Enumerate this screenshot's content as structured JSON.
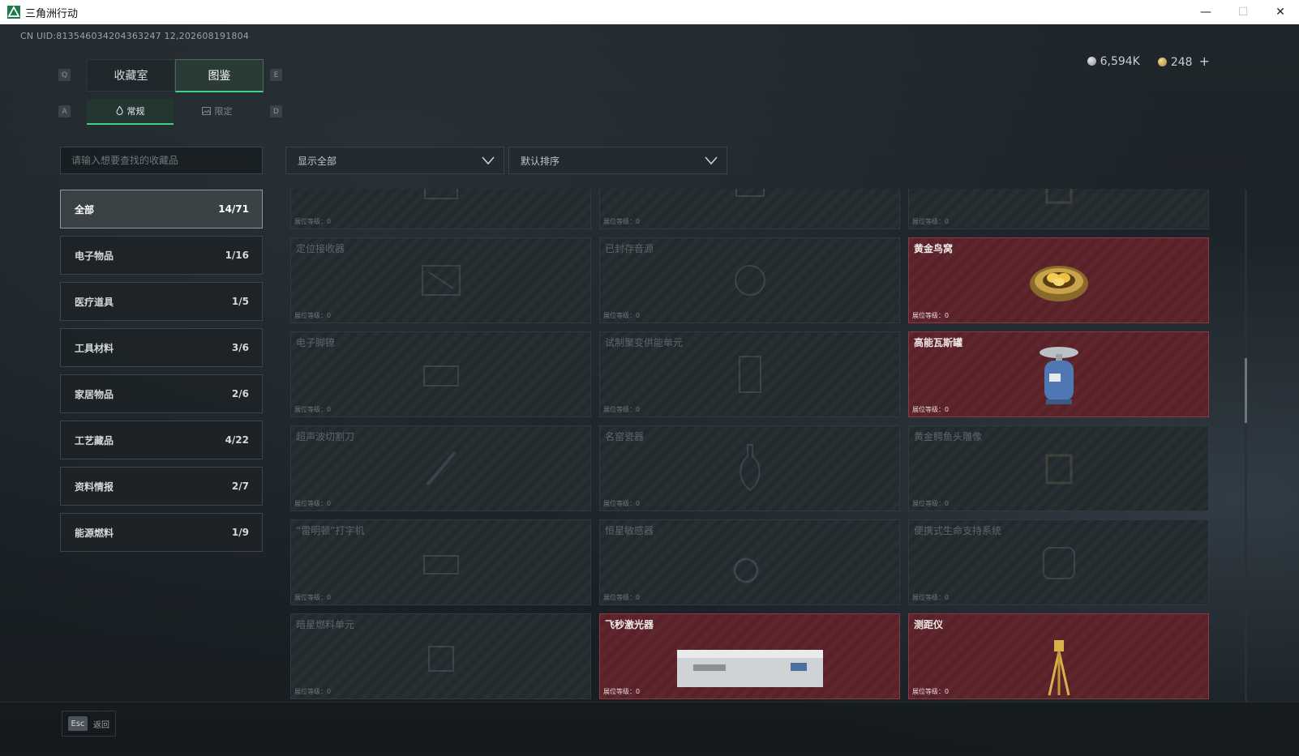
{
  "window": {
    "title": "三角洲行动",
    "minimize": "—",
    "maximize": "☐",
    "close": "✕"
  },
  "uid": "CN UID:813546034204363247 12,202608191804",
  "currency": {
    "silver": "6,594K",
    "gold": "248",
    "add": "+"
  },
  "hotkeys": {
    "q": "Q",
    "e": "E",
    "a": "A",
    "d": "D"
  },
  "tabs_main": [
    "收藏室",
    "图鉴"
  ],
  "tabs_sub": [
    "常规",
    "限定"
  ],
  "search": {
    "placeholder": "请输入想要查找的收藏品"
  },
  "filters": {
    "display": "显示全部",
    "sort": "默认排序"
  },
  "categories": [
    {
      "label": "全部",
      "count": "14/71"
    },
    {
      "label": "电子物品",
      "count": "1/16"
    },
    {
      "label": "医疗道具",
      "count": "1/5"
    },
    {
      "label": "工具材料",
      "count": "3/6"
    },
    {
      "label": "家居物品",
      "count": "2/6"
    },
    {
      "label": "工艺藏品",
      "count": "4/22"
    },
    {
      "label": "资料情报",
      "count": "2/7"
    },
    {
      "label": "能源燃料",
      "count": "1/9"
    }
  ],
  "level_label": "展位等级：0",
  "items": [
    {
      "name": "",
      "owned": false,
      "icon": "gadget-icon"
    },
    {
      "name": "",
      "owned": false,
      "icon": "device-icon"
    },
    {
      "name": "",
      "owned": false,
      "icon": "frame-icon"
    },
    {
      "name": "定位接收器",
      "owned": false,
      "icon": "receiver-icon"
    },
    {
      "name": "已封存音源",
      "owned": false,
      "icon": "audio-icon"
    },
    {
      "name": "黄金鸟窝",
      "owned": true,
      "icon": "golden-nest-icon"
    },
    {
      "name": "电子脚镣",
      "owned": false,
      "icon": "shackle-icon"
    },
    {
      "name": "试制聚变供能单元",
      "owned": false,
      "icon": "fusion-cell-icon"
    },
    {
      "name": "高能瓦斯罐",
      "owned": true,
      "icon": "gas-tank-icon"
    },
    {
      "name": "超声波切割刀",
      "owned": false,
      "icon": "knife-icon"
    },
    {
      "name": "名窑瓷器",
      "owned": false,
      "icon": "vase-icon"
    },
    {
      "name": "黄金鳄鱼头雕像",
      "owned": false,
      "icon": "croc-statue-icon"
    },
    {
      "name": "“雷明顿”打字机",
      "owned": false,
      "icon": "typewriter-icon"
    },
    {
      "name": "恒星敏感器",
      "owned": false,
      "icon": "sensor-icon"
    },
    {
      "name": "便携式生命支持系统",
      "owned": false,
      "icon": "life-support-icon"
    },
    {
      "name": "暗星燃料单元",
      "owned": false,
      "icon": "fuel-cell-icon"
    },
    {
      "name": "飞秒激光器",
      "owned": true,
      "icon": "laser-icon"
    },
    {
      "name": "测距仪",
      "owned": true,
      "icon": "rangefinder-icon"
    }
  ],
  "footer": {
    "esc_key": "Esc",
    "back": "返回"
  }
}
